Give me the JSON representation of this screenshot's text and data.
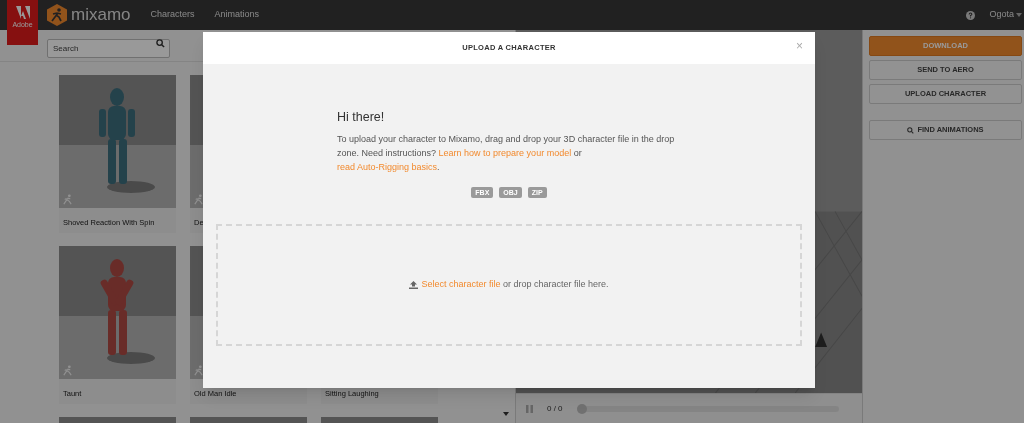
{
  "nav": {
    "brand": "mixamo",
    "adobe_label": "Adobe",
    "links": [
      {
        "label": "Characters",
        "selected": false
      },
      {
        "label": "Animations",
        "selected": false
      }
    ],
    "user": "Ogota"
  },
  "search": {
    "placeholder": "Search"
  },
  "cards": [
    {
      "label": "Shoved Reaction With Spin"
    },
    {
      "label": "De"
    },
    {
      "label": "Taunt"
    },
    {
      "label": "Old Man Idle"
    },
    {
      "label": "Sitting Laughing"
    }
  ],
  "player": {
    "time": "0 / 0",
    "level": 0
  },
  "right_panel": {
    "buttons": [
      {
        "label": "DOWNLOAD",
        "kind": "primary"
      },
      {
        "label": "SEND TO AERO",
        "kind": "secondary"
      },
      {
        "label": "UPLOAD CHARACTER",
        "kind": "secondary"
      },
      {
        "label": "FIND ANIMATIONS",
        "kind": "search"
      }
    ]
  },
  "modal": {
    "title": "UPLOAD A CHARACTER",
    "close": "×",
    "heading": "Hi there!",
    "intro": [
      {
        "kind": "text",
        "text": "To upload your character to Mixamo, drag and drop your 3D character file in the drop zone. Need instructions? "
      },
      {
        "kind": "link",
        "text": "Learn how to prepare your model"
      },
      {
        "kind": "text",
        "text": " or "
      },
      {
        "kind": "link",
        "text": "read Auto-Rigging basics"
      },
      {
        "kind": "text",
        "text": "."
      }
    ],
    "formats": [
      "FBX",
      "OBJ",
      "ZIP"
    ],
    "drop_zone": {
      "link": "Select character file",
      "text": " or drop character file here."
    }
  }
}
